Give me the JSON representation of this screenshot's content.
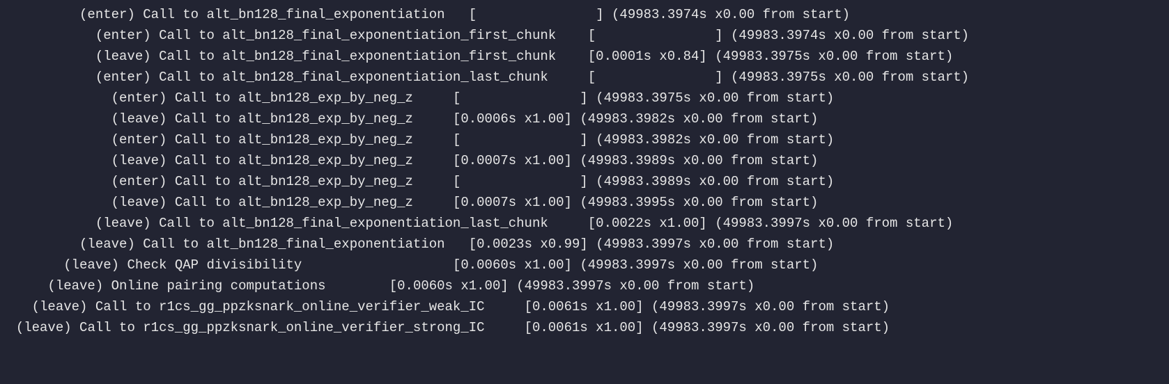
{
  "lines": [
    {
      "indent": 10,
      "event": "(enter)",
      "label": "Call to alt_bn128_final_exponentiation",
      "gap1": 3,
      "bracket": "[               ]",
      "gap2": 1,
      "meta": "(49983.3974s x0.00 from start)"
    },
    {
      "indent": 12,
      "event": "(enter)",
      "label": "Call to alt_bn128_final_exponentiation_first_chunk",
      "gap1": 4,
      "bracket": "[               ]",
      "gap2": 1,
      "meta": "(49983.3974s x0.00 from start)"
    },
    {
      "indent": 12,
      "event": "(leave)",
      "label": "Call to alt_bn128_final_exponentiation_first_chunk",
      "gap1": 4,
      "bracket": "[0.0001s x0.84]",
      "gap2": 1,
      "meta": "(49983.3975s x0.00 from start)"
    },
    {
      "indent": 12,
      "event": "(enter)",
      "label": "Call to alt_bn128_final_exponentiation_last_chunk",
      "gap1": 5,
      "bracket": "[               ]",
      "gap2": 1,
      "meta": "(49983.3975s x0.00 from start)"
    },
    {
      "indent": 14,
      "event": "(enter)",
      "label": "Call to alt_bn128_exp_by_neg_z",
      "gap1": 5,
      "bracket": "[               ]",
      "gap2": 1,
      "meta": "(49983.3975s x0.00 from start)"
    },
    {
      "indent": 14,
      "event": "(leave)",
      "label": "Call to alt_bn128_exp_by_neg_z",
      "gap1": 5,
      "bracket": "[0.0006s x1.00]",
      "gap2": 1,
      "meta": "(49983.3982s x0.00 from start)"
    },
    {
      "indent": 14,
      "event": "(enter)",
      "label": "Call to alt_bn128_exp_by_neg_z",
      "gap1": 5,
      "bracket": "[               ]",
      "gap2": 1,
      "meta": "(49983.3982s x0.00 from start)"
    },
    {
      "indent": 14,
      "event": "(leave)",
      "label": "Call to alt_bn128_exp_by_neg_z",
      "gap1": 5,
      "bracket": "[0.0007s x1.00]",
      "gap2": 1,
      "meta": "(49983.3989s x0.00 from start)"
    },
    {
      "indent": 14,
      "event": "(enter)",
      "label": "Call to alt_bn128_exp_by_neg_z",
      "gap1": 5,
      "bracket": "[               ]",
      "gap2": 1,
      "meta": "(49983.3989s x0.00 from start)"
    },
    {
      "indent": 14,
      "event": "(leave)",
      "label": "Call to alt_bn128_exp_by_neg_z",
      "gap1": 5,
      "bracket": "[0.0007s x1.00]",
      "gap2": 1,
      "meta": "(49983.3995s x0.00 from start)"
    },
    {
      "indent": 12,
      "event": "(leave)",
      "label": "Call to alt_bn128_final_exponentiation_last_chunk",
      "gap1": 5,
      "bracket": "[0.0022s x1.00]",
      "gap2": 1,
      "meta": "(49983.3997s x0.00 from start)"
    },
    {
      "indent": 10,
      "event": "(leave)",
      "label": "Call to alt_bn128_final_exponentiation",
      "gap1": 3,
      "bracket": "[0.0023s x0.99]",
      "gap2": 1,
      "meta": "(49983.3997s x0.00 from start)"
    },
    {
      "indent": 8,
      "event": "(leave)",
      "label": "Check QAP divisibility",
      "gap1": 19,
      "bracket": "[0.0060s x1.00]",
      "gap2": 1,
      "meta": "(49983.3997s x0.00 from start)"
    },
    {
      "indent": 6,
      "event": "(leave)",
      "label": "Online pairing computations",
      "gap1": 8,
      "bracket": "[0.0060s x1.00]",
      "gap2": 1,
      "meta": "(49983.3997s x0.00 from start)"
    },
    {
      "indent": 4,
      "event": "(leave)",
      "label": "Call to r1cs_gg_ppzksnark_online_verifier_weak_IC",
      "gap1": 5,
      "bracket": "[0.0061s x1.00]",
      "gap2": 1,
      "meta": "(49983.3997s x0.00 from start)"
    },
    {
      "indent": 2,
      "event": "(leave)",
      "label": "Call to r1cs_gg_ppzksnark_online_verifier_strong_IC",
      "gap1": 5,
      "bracket": "[0.0061s x1.00]",
      "gap2": 1,
      "meta": "(49983.3997s x0.00 from start)"
    }
  ]
}
